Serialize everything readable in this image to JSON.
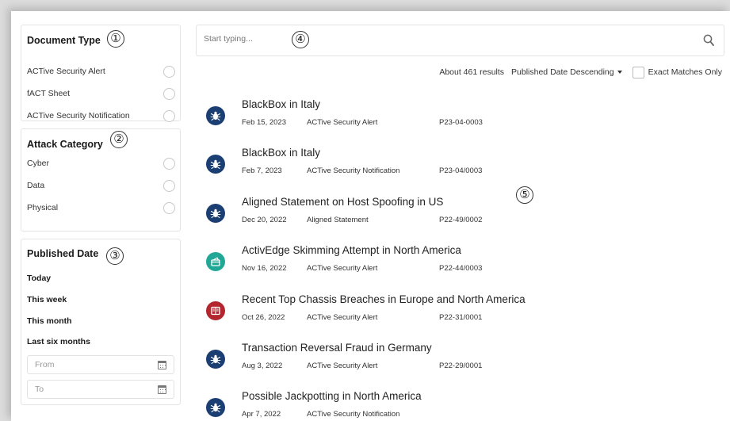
{
  "filters": {
    "document_type": {
      "title": "Document Type",
      "annotation": "①",
      "options": [
        "ACTive Security Alert",
        "fACT Sheet",
        "ACTive Security Notification"
      ]
    },
    "attack_category": {
      "title": "Attack Category",
      "annotation": "②",
      "options": [
        "Cyber",
        "Data",
        "Physical"
      ]
    },
    "published_date": {
      "title": "Published Date",
      "annotation": "③",
      "presets": [
        "Today",
        "This week",
        "This month",
        "Last six months"
      ],
      "from_placeholder": "From",
      "to_placeholder": "To"
    }
  },
  "search": {
    "placeholder": "Start typing...",
    "value": "",
    "annotation": "④"
  },
  "results_bar": {
    "count_text": "About 461 results",
    "sort_label": "Published Date Descending",
    "exact_label": "Exact Matches Only"
  },
  "results_annotation": "⑤",
  "colors": {
    "navy": "#1b3f73",
    "teal": "#21a796",
    "red": "#b3262e"
  },
  "results": [
    {
      "title": "BlackBox in Italy",
      "date": "Feb 15, 2023",
      "type": "ACTive Security Alert",
      "code": "P23-04-0003",
      "icon": "bug-icon"
    },
    {
      "title": "BlackBox in Italy",
      "date": "Feb 7, 2023",
      "type": "ACTive Security Notification",
      "code": "P23-04/0003",
      "icon": "bug-icon"
    },
    {
      "title": "Aligned Statement on Host Spoofing in US",
      "date": "Dec 20, 2022",
      "type": "Aligned Statement",
      "code": "P22-49/0002",
      "icon": "bug-icon"
    },
    {
      "title": "ActivEdge Skimming Attempt in North America",
      "date": "Nov 16, 2022",
      "type": "ACTive Security Alert",
      "code": "P22-44/0003",
      "icon": "card-icon"
    },
    {
      "title": "Recent Top Chassis Breaches in Europe and North America",
      "date": "Oct 26, 2022",
      "type": "ACTive Security Alert",
      "code": "P22-31/0001",
      "icon": "document-icon"
    },
    {
      "title": "Transaction Reversal Fraud in Germany",
      "date": "Aug 3, 2022",
      "type": "ACTive Security Alert",
      "code": "P22-29/0001",
      "icon": "bug-icon"
    },
    {
      "title": "Possible Jackpotting in North America",
      "date": "Apr 7, 2022",
      "type": "ACTive Security Notification",
      "code": "",
      "icon": "bug-icon"
    }
  ]
}
